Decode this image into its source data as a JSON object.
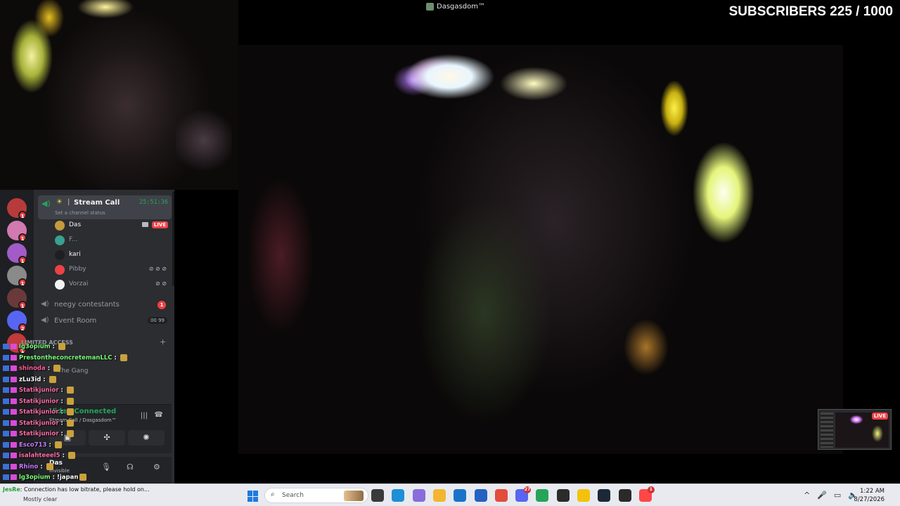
{
  "window": {
    "title": "Dasgasdom™"
  },
  "overlay": {
    "subscribers": "SUBSCRIBERS 225 / 1000"
  },
  "discord": {
    "servers": [
      {
        "badge": "1",
        "color": "#b83b3b"
      },
      {
        "badge": "1",
        "color": "#d07ab0"
      },
      {
        "badge": "1",
        "color": "#a25bc7"
      },
      {
        "badge": "1",
        "color": "#8a8a8a"
      },
      {
        "badge": "1",
        "color": "#6a3a3a"
      },
      {
        "badge": "2",
        "color": "#5865f2"
      },
      {
        "badge": "1",
        "color": "#c23a3a"
      }
    ],
    "voice_channel": {
      "name": "Stream Call",
      "timer": "25:51:36",
      "status": "Set a channel status"
    },
    "members": [
      {
        "name": "Das",
        "color": "#f2f3f5",
        "live": "LIVE",
        "avatar": "#c49a3e"
      },
      {
        "name": "F...",
        "color": "#949ba4",
        "avatar": "#3aa08f"
      },
      {
        "name": "kari",
        "color": "#f2f3f5",
        "avatar": "#1e1f22"
      },
      {
        "name": "Pibby",
        "color": "#949ba4",
        "avatar": "#ed4245",
        "icons": "⊘ ⊘ ⊘"
      },
      {
        "name": "Vorzai",
        "color": "#949ba4",
        "avatar": "#f2f3f5",
        "icons": "⊘ ⊘"
      }
    ],
    "channels": [
      {
        "name": "neegy contestants",
        "badge": "1"
      },
      {
        "name": "Event Room",
        "count": "00 99"
      }
    ],
    "category": "LIMITED ACCESS",
    "extra_channel": "The Gang",
    "voice_connected": {
      "title": "Video Connected",
      "subtitle": "Stream Call / Dasgasdom™"
    },
    "user": {
      "name": "Das",
      "status": "Invisible"
    }
  },
  "chat": [
    {
      "user": "lg3opium",
      "color": "#7cff7c",
      "msg": ""
    },
    {
      "user": "PrestontheconcretemanLLC",
      "color": "#7cff7c",
      "msg": ""
    },
    {
      "user": "shinoda",
      "color": "#ff5fa0",
      "msg": ""
    },
    {
      "user": "zLu3id",
      "color": "#ffffff",
      "msg": ""
    },
    {
      "user": "Statikjunior",
      "color": "#ff6fa8",
      "msg": ""
    },
    {
      "user": "Statikjunior",
      "color": "#ff6fa8",
      "msg": ""
    },
    {
      "user": "Statikjunior",
      "color": "#ff6fa8",
      "msg": ""
    },
    {
      "user": "Statikjunior",
      "color": "#ff6fa8",
      "msg": ""
    },
    {
      "user": "Statikjunior",
      "color": "#ff6fa8",
      "msg": ""
    },
    {
      "user": "Esco713",
      "color": "#c77dff",
      "msg": ""
    },
    {
      "user": "isalahteeel5",
      "color": "#ff6fa8",
      "msg": ""
    },
    {
      "user": "Rhino",
      "color": "#c77dff",
      "msg": ""
    },
    {
      "user": "lg3opium",
      "color": "#7cff7c",
      "msg": "!japan"
    }
  ],
  "preview": {
    "live": "LIVE"
  },
  "taskbar": {
    "notification_user": "JesRe",
    "notification_msg": "Connection has low bitrate, please hold on...",
    "weather": "Mostly clear",
    "search_placeholder": "Search",
    "apps": [
      {
        "name": "task-view",
        "color": "#3a3a3a"
      },
      {
        "name": "edge",
        "color": "#1f8fd6"
      },
      {
        "name": "copilot",
        "color": "#8a6cdb"
      },
      {
        "name": "file-explorer",
        "color": "#f2b630"
      },
      {
        "name": "outlook",
        "color": "#1a73c9"
      },
      {
        "name": "store",
        "color": "#2561c0"
      },
      {
        "name": "chrome",
        "color": "#e24d3c"
      },
      {
        "name": "discord",
        "color": "#5865f2",
        "badge": "27"
      },
      {
        "name": "chrome-alt",
        "color": "#27a35a"
      },
      {
        "name": "obs",
        "color": "#2b2b2b"
      },
      {
        "name": "norton",
        "color": "#f4c20d"
      },
      {
        "name": "steam",
        "color": "#1b2838"
      },
      {
        "name": "epic-games",
        "color": "#2a2a2a"
      },
      {
        "name": "ea",
        "color": "#ff4747",
        "badge": "1"
      }
    ],
    "time": "1:22 AM",
    "date": "8/27/2026"
  }
}
